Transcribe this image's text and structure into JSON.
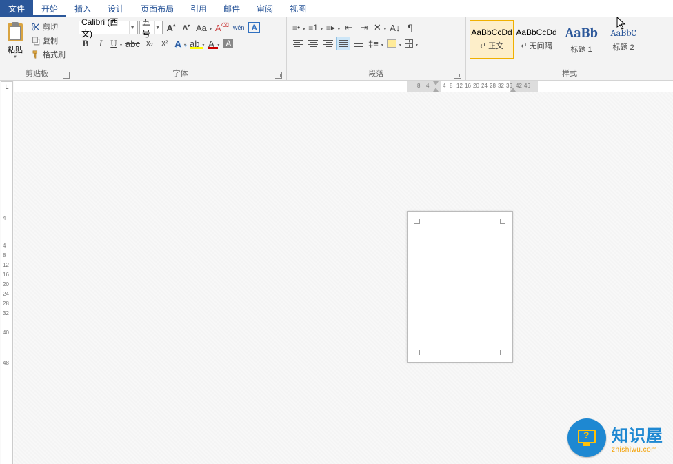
{
  "menu": {
    "file": "文件",
    "home": "开始",
    "insert": "插入",
    "design": "设计",
    "layout": "页面布局",
    "references": "引用",
    "mail": "邮件",
    "review": "审阅",
    "view": "视图"
  },
  "clipboard": {
    "paste": "粘贴",
    "cut": "剪切",
    "copy": "复制",
    "format_painter": "格式刷",
    "group_label": "剪贴板"
  },
  "font": {
    "name": "Calibri (西文)",
    "size": "五号",
    "grow": "A",
    "shrink": "A",
    "change_case": "Aa",
    "clear_format": "A",
    "phonetic": "wén",
    "char_border": "A",
    "bold": "B",
    "italic": "I",
    "underline": "U",
    "strike": "abc",
    "subscript": "x₂",
    "superscript": "x²",
    "text_effects": "A",
    "highlight": "ab",
    "font_color": "A",
    "char_shading": "A",
    "group_label": "字体"
  },
  "paragraph": {
    "group_label": "段落"
  },
  "styles": {
    "items": [
      {
        "preview": "AaBbCcDd",
        "name": "↵ 正文"
      },
      {
        "preview": "AaBbCcDd",
        "name": "↵ 无间隔"
      },
      {
        "preview": "AaBb",
        "name": "标题 1"
      },
      {
        "preview": "AaBbC",
        "name": "标题 2"
      }
    ],
    "group_label": "样式"
  },
  "ruler": {
    "corner": "L",
    "h_numbers": [
      "8",
      "4",
      "4",
      "8",
      "12",
      "16",
      "20",
      "24",
      "28",
      "32",
      "36",
      "42",
      "46"
    ],
    "v_numbers": [
      "4",
      "4",
      "8",
      "12",
      "16",
      "20",
      "24",
      "28",
      "32",
      "40",
      "48"
    ]
  },
  "watermark": {
    "title": "知识屋",
    "url": "zhishiwu.com"
  }
}
